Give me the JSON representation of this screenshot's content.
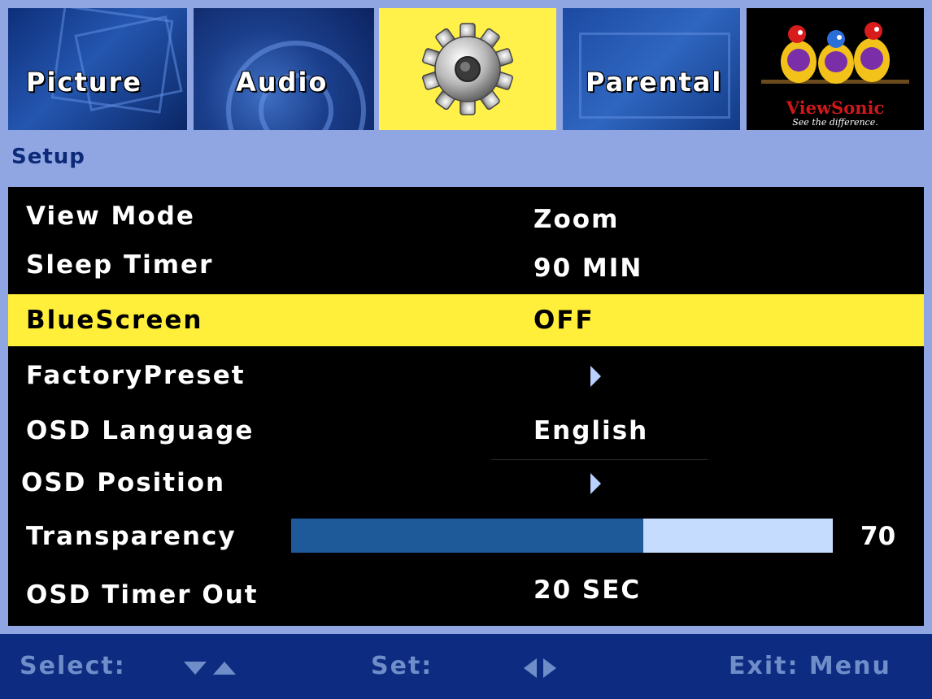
{
  "tabs": {
    "picture": "Picture",
    "audio": "Audio",
    "parental": "Parental"
  },
  "brand": {
    "name": "ViewSonic",
    "tagline": "See the difference."
  },
  "section_title": "Setup",
  "menu": {
    "view_mode": {
      "label": "View Mode",
      "value": "Zoom"
    },
    "sleep_timer": {
      "label": "Sleep Timer",
      "value": "90 MIN"
    },
    "blue_screen": {
      "label": "BlueScreen",
      "value": "OFF"
    },
    "factory_preset": {
      "label": "FactoryPreset"
    },
    "osd_language": {
      "label": "OSD Language",
      "value": "English"
    },
    "osd_position": {
      "label": "OSD Position"
    },
    "transparency": {
      "label": "Transparency",
      "value": "70",
      "level": 0.65
    },
    "osd_timer_out": {
      "label": "OSD Timer Out",
      "value": "20 SEC"
    }
  },
  "footer": {
    "select": "Select:",
    "set": "Set:",
    "exit": "Exit: Menu"
  },
  "colors": {
    "frame": "#8fa6e2",
    "highlight": "#ffef3a",
    "slider_fill": "#1e5a99",
    "slider_track": "#c6dcff",
    "footer_bg": "#0d2b80",
    "footer_text": "#6f8dc9",
    "brand_red": "#d01818"
  },
  "icons": {
    "setup_tab": "gear-icon",
    "brand": "parrots-logo-icon",
    "submenu": "arrow-right-icon",
    "select_hint": "up-down-arrows-icon",
    "set_hint": "left-right-arrows-icon"
  }
}
